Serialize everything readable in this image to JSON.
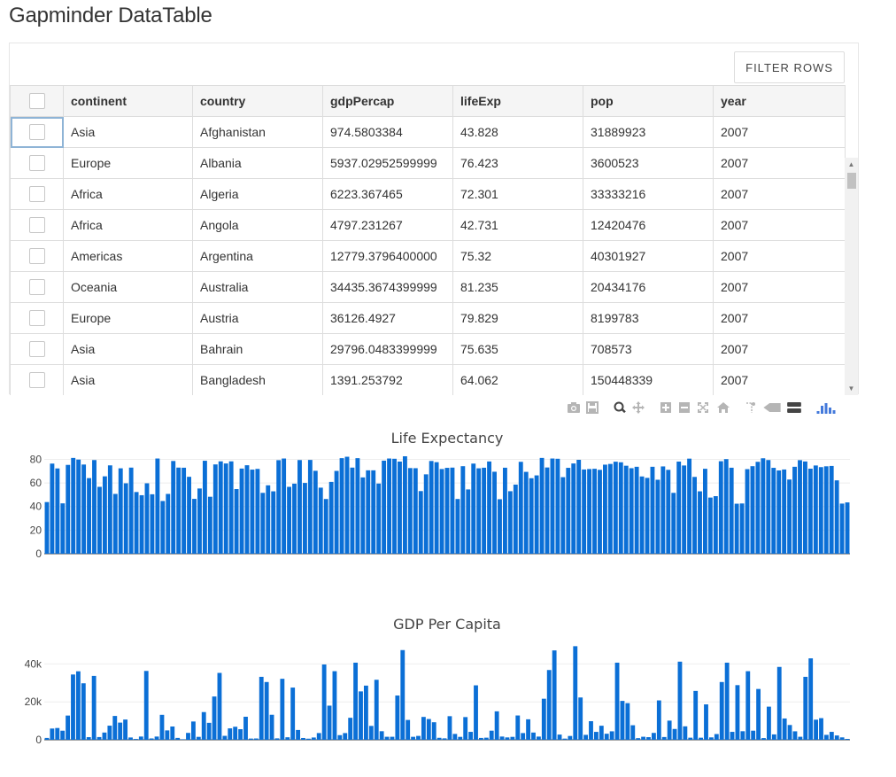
{
  "page": {
    "title": "Gapminder DataTable"
  },
  "toolbar": {
    "filter_label": "FILTER ROWS"
  },
  "table": {
    "columns": [
      "continent",
      "country",
      "gdpPercap",
      "lifeExp",
      "pop",
      "year"
    ],
    "rows": [
      [
        "Asia",
        "Afghanistan",
        "974.5803384",
        "43.828",
        "31889923",
        "2007"
      ],
      [
        "Europe",
        "Albania",
        "5937.02952599999",
        "76.423",
        "3600523",
        "2007"
      ],
      [
        "Africa",
        "Algeria",
        "6223.367465",
        "72.301",
        "33333216",
        "2007"
      ],
      [
        "Africa",
        "Angola",
        "4797.231267",
        "42.731",
        "12420476",
        "2007"
      ],
      [
        "Americas",
        "Argentina",
        "12779.3796400000",
        "75.32",
        "40301927",
        "2007"
      ],
      [
        "Oceania",
        "Australia",
        "34435.3674399999",
        "81.235",
        "20434176",
        "2007"
      ],
      [
        "Europe",
        "Austria",
        "36126.4927",
        "79.829",
        "8199783",
        "2007"
      ],
      [
        "Asia",
        "Bahrain",
        "29796.0483399999",
        "75.635",
        "708573",
        "2007"
      ],
      [
        "Asia",
        "Bangladesh",
        "1391.253792",
        "64.062",
        "150448339",
        "2007"
      ]
    ]
  },
  "modebar": {
    "icons": [
      "camera-icon",
      "save-icon",
      "zoom-icon",
      "pan-icon",
      "zoom-in-icon",
      "zoom-out-icon",
      "autoscale-icon",
      "home-icon",
      "spike-lines-icon",
      "hover-closest-icon",
      "hover-compare-icon",
      "plotly-logo-icon"
    ]
  },
  "colors": {
    "bar": "#1f77b4",
    "bar_fill": "#0b6fd6",
    "grid": "#eeeeee",
    "text": "#444444"
  },
  "chart_data": [
    {
      "type": "bar",
      "title": "Life Expectancy",
      "xlabel": "",
      "ylabel": "",
      "ylim": [
        0,
        82.6
      ],
      "yticks": [
        0,
        20,
        40,
        60,
        80
      ],
      "ytick_labels": [
        "0",
        "20",
        "40",
        "60",
        "80"
      ],
      "grid": true,
      "values": [
        43.8,
        76.4,
        72.3,
        42.7,
        75.3,
        81.2,
        79.8,
        75.6,
        64.1,
        79.4,
        56.7,
        65.6,
        74.9,
        50.7,
        72.4,
        59.7,
        73.0,
        52.3,
        49.6,
        59.7,
        50.4,
        80.7,
        44.7,
        50.7,
        78.6,
        73.0,
        72.9,
        65.2,
        46.5,
        55.3,
        78.8,
        48.3,
        75.7,
        78.3,
        76.5,
        78.3,
        54.8,
        72.2,
        75.0,
        71.3,
        71.9,
        51.6,
        58.0,
        52.9,
        79.3,
        80.7,
        56.7,
        59.4,
        79.4,
        60.0,
        79.5,
        70.3,
        56.0,
        46.4,
        60.9,
        70.2,
        81.0,
        82.2,
        73.0,
        81.0,
        64.7,
        70.7,
        70.7,
        59.5,
        78.9,
        80.7,
        80.5,
        78.1,
        82.6,
        72.6,
        72.5,
        53.1,
        67.3,
        78.6,
        77.6,
        71.8,
        72.8,
        73.0,
        46.4,
        74.2,
        54.5,
        76.4,
        72.4,
        72.9,
        78.2,
        69.5,
        46.2,
        72.9,
        53.0,
        58.6,
        77.9,
        69.4,
        64.0,
        66.4,
        81.2,
        73.1,
        80.7,
        80.5,
        64.9,
        72.8,
        76.5,
        79.6,
        71.4,
        71.8,
        72.0,
        71.1,
        75.5,
        76.1,
        78.0,
        77.5,
        74.6,
        72.5,
        73.7,
        65.5,
        64.3,
        73.7,
        62.7,
        74.0,
        71.1,
        51.6,
        78.1,
        74.8,
        80.6,
        65.1,
        52.9,
        72.0,
        47.6,
        48.8,
        78.4,
        80.2,
        72.9,
        42.4,
        42.6,
        71.7,
        74.2,
        77.9,
        80.9,
        79.4,
        72.8,
        70.6,
        71.4,
        62.9,
        73.7,
        79.3,
        78.2,
        72.1,
        74.8,
        73.4,
        74.1,
        74.4,
        62.2,
        42.5,
        43.5
      ],
      "color": "#0b6fd6"
    },
    {
      "type": "bar",
      "title": "GDP Per Capita",
      "xlabel": "",
      "ylabel": "",
      "ylim": [
        0,
        50000
      ],
      "yticks": [
        0,
        20000,
        40000
      ],
      "ytick_labels": [
        "0",
        "20k",
        "40k"
      ],
      "grid": true,
      "values": [
        975,
        5937,
        6223,
        4797,
        12779,
        34435,
        36126,
        29796,
        1391,
        33693,
        1441,
        3822,
        7446,
        12570,
        9065,
        10681,
        1217,
        430,
        1714,
        36319,
        706,
        1704,
        13172,
        4959,
        7006,
        986,
        277,
        3633,
        9645,
        1545,
        14619,
        8948,
        22833,
        35278,
        2082,
        6025,
        6873,
        5581,
        12154,
        641,
        690,
        33207,
        30470,
        13206,
        752,
        32170,
        1328,
        27538,
        5186,
        942,
        580,
        1202,
        3548,
        39725,
        18009,
        36181,
        2452,
        3541,
        11606,
        40676,
        25523,
        28570,
        7321,
        31656,
        4519,
        1594,
        1593,
        23348,
        47307,
        10461,
        1570,
        2049,
        12057,
        10957,
        9254,
        1043,
        760,
        12452,
        3096,
        1545,
        11978,
        4184,
        28718,
        975,
        1110,
        4811,
        15009,
        1713,
        1250,
        1544,
        12823,
        3543,
        10808,
        3822,
        1694,
        21655,
        36797,
        47143,
        2749,
        619,
        2014,
        49357,
        22316,
        2606,
        9809,
        4173,
        7409,
        3190,
        4470,
        40676,
        20510,
        19329,
        7670,
        863,
        1598,
        1391,
        3632,
        20774,
        1463,
        10109,
        5716,
        41209,
        7100,
        1112,
        25768,
        1099,
        18678,
        1270,
        3025,
        30470,
        40675,
        4184,
        28821,
        4519,
        36181,
        4805,
        26802,
        896,
        17473,
        2844,
        38435,
        11237,
        7801,
        4471,
        1595,
        33208,
        42952,
        10611,
        11416,
        2602,
        4181,
        2281,
        1271,
        469
      ]
    }
  ]
}
